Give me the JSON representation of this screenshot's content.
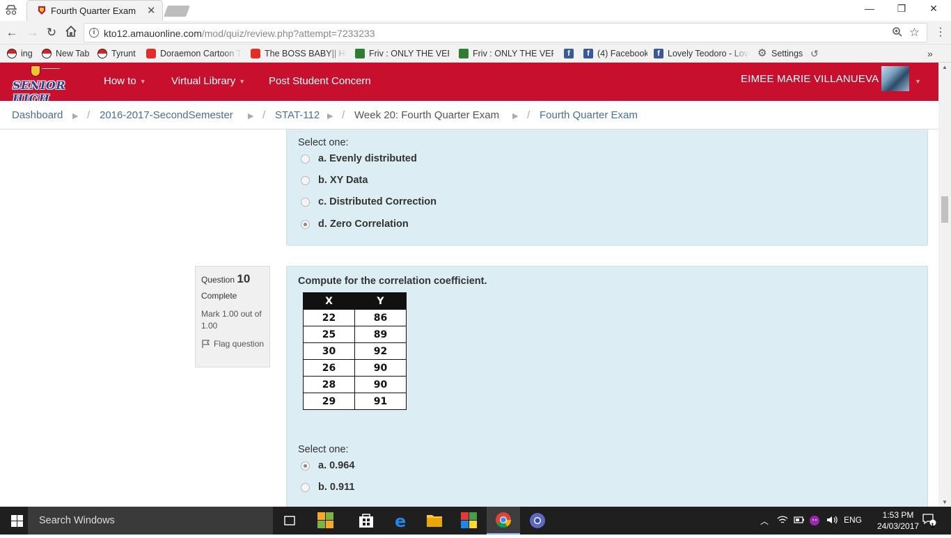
{
  "browser": {
    "tab_title": "Fourth Quarter Exam",
    "url_host": "kto12.amauonline.com",
    "url_path": "/mod/quiz/review.php?attempt=7233233",
    "bookmarks": [
      {
        "label": "ing",
        "icon": "pokeball-icon"
      },
      {
        "label": "New Tab",
        "icon": "pokeball-icon"
      },
      {
        "label": "Tyrunt",
        "icon": "pokeball-icon"
      },
      {
        "label": "Doraemon Cartoon Th",
        "icon": "youtube-icon"
      },
      {
        "label": "The BOSS BABY|| Hind",
        "icon": "youtube-icon"
      },
      {
        "label": "Friv : ONLY THE VERY",
        "icon": "friv-icon"
      },
      {
        "label": "Friv : ONLY THE VERY",
        "icon": "friv-icon"
      },
      {
        "label": "",
        "icon": "facebook-icon"
      },
      {
        "label": "(4) Facebook",
        "icon": "facebook-icon"
      },
      {
        "label": "Lovely Teodoro - Love",
        "icon": "facebook-icon"
      },
      {
        "label": "Settings",
        "icon": "gear-icon"
      }
    ]
  },
  "site": {
    "logo_text": "SENIOR HIGH",
    "nav": [
      {
        "label": "How to",
        "has_caret": true
      },
      {
        "label": "Virtual Library",
        "has_caret": true
      },
      {
        "label": "Post Student Concern",
        "has_caret": false
      }
    ],
    "user_name": "EIMEE MARIE VILLANUEVA"
  },
  "breadcrumb": [
    {
      "label": "Dashboard",
      "link": true
    },
    {
      "label": "2016-2017-SecondSemester",
      "link": true
    },
    {
      "label": "STAT-112",
      "link": true
    },
    {
      "label": "Week 20: Fourth Quarter Exam",
      "link": false
    },
    {
      "label": "Fourth Quarter Exam",
      "link": true
    }
  ],
  "breadcrumb_separator": "▶",
  "question9": {
    "select_one": "Select one:",
    "options": [
      {
        "label": "a. Evenly distributed",
        "selected": false
      },
      {
        "label": "b. XY Data",
        "selected": false
      },
      {
        "label": "c. Distributed Correction",
        "selected": false
      },
      {
        "label": "d. Zero Correlation",
        "selected": true
      }
    ]
  },
  "question10": {
    "question_label": "Question",
    "number": "10",
    "state": "Complete",
    "grade": "Mark 1.00 out of 1.00",
    "flag_label": "Flag question",
    "text": "Compute for the correlation coefficient.",
    "table": {
      "headers": [
        "X",
        "Y"
      ],
      "rows": [
        [
          "22",
          "86"
        ],
        [
          "25",
          "89"
        ],
        [
          "30",
          "92"
        ],
        [
          "26",
          "90"
        ],
        [
          "28",
          "90"
        ],
        [
          "29",
          "91"
        ]
      ]
    },
    "select_one": "Select one:",
    "options": [
      {
        "label": "a. 0.964",
        "selected": true
      },
      {
        "label": "b. 0.911",
        "selected": false
      }
    ]
  },
  "taskbar": {
    "search_placeholder": "Search Windows",
    "language": "ENG",
    "time": "1:53 PM",
    "date": "24/03/2017",
    "notification_count": "1"
  },
  "colors": {
    "brand_red": "#c8102e",
    "question_bg": "#dcedf3",
    "link": "#4a6d9a"
  }
}
